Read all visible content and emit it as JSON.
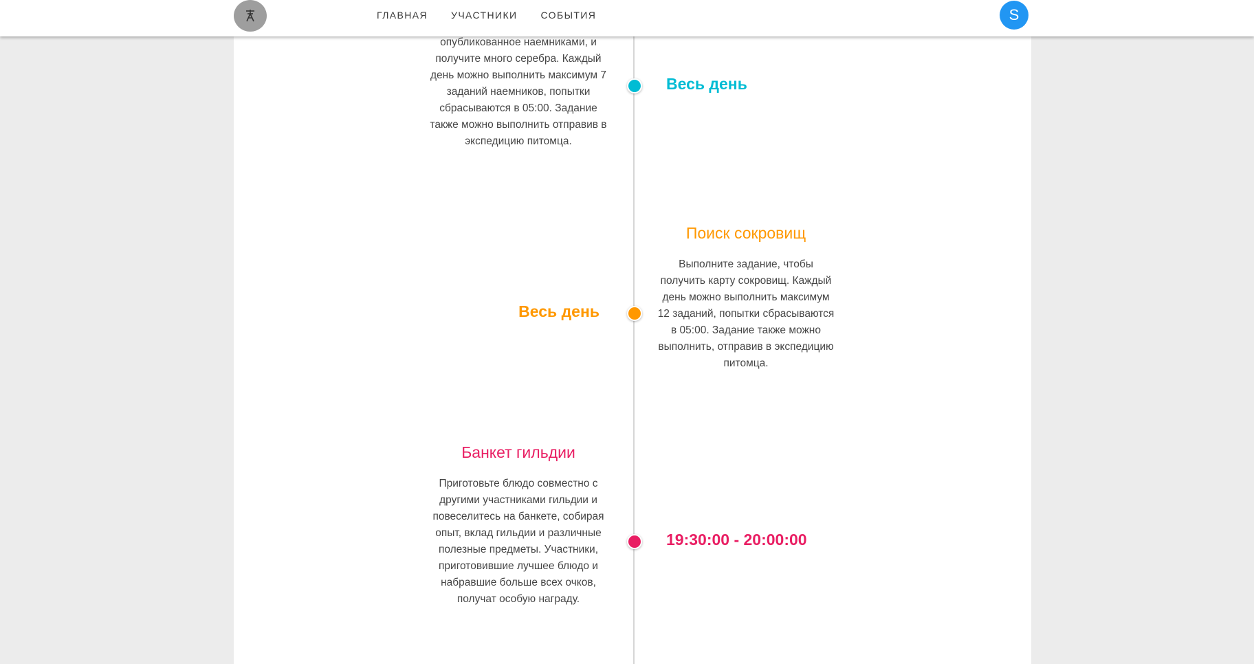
{
  "nav": {
    "items": [
      "ГЛАВНАЯ",
      "УЧАСТНИКИ",
      "СОБЫТИЯ"
    ],
    "avatar_letter": "S",
    "logo_icon": "totem-pole-icon"
  },
  "colors": {
    "cyan": "#00bcd4",
    "orange": "#ff9800",
    "pink": "#e91e63",
    "avatar_blue": "#2196f3"
  },
  "events": [
    {
      "title": "",
      "time": "Весь день",
      "description": "опубликованное наемниками, и получите много серебра. Каждый день можно выполнить максимум 7 заданий наемников, попытки сбрасываются в 05:00. Задание также можно выполнить отправив в экспедицию питомца.",
      "color": "#00bcd4"
    },
    {
      "title": "Поиск сокровищ",
      "time": "Весь день",
      "description": "Выполните задание, чтобы получить карту сокровищ. Каждый день можно выполнить максимум 12 заданий, попытки сбрасываются в 05:00. Задание также можно выполнить, отправив в экспедицию питомца.",
      "color": "#ff9800"
    },
    {
      "title": "Банкет гильдии",
      "time": "19:30:00 - 20:00:00",
      "description": "Приготовьте блюдо совместно с другими участниками гильдии и повеселитесь на банкете, собирая опыт, вклад гильдии и различные полезные предметы. Участники, приготовившие лучшее блюдо и набравшие больше всех очков, получат особую награду.",
      "color": "#e91e63"
    }
  ]
}
